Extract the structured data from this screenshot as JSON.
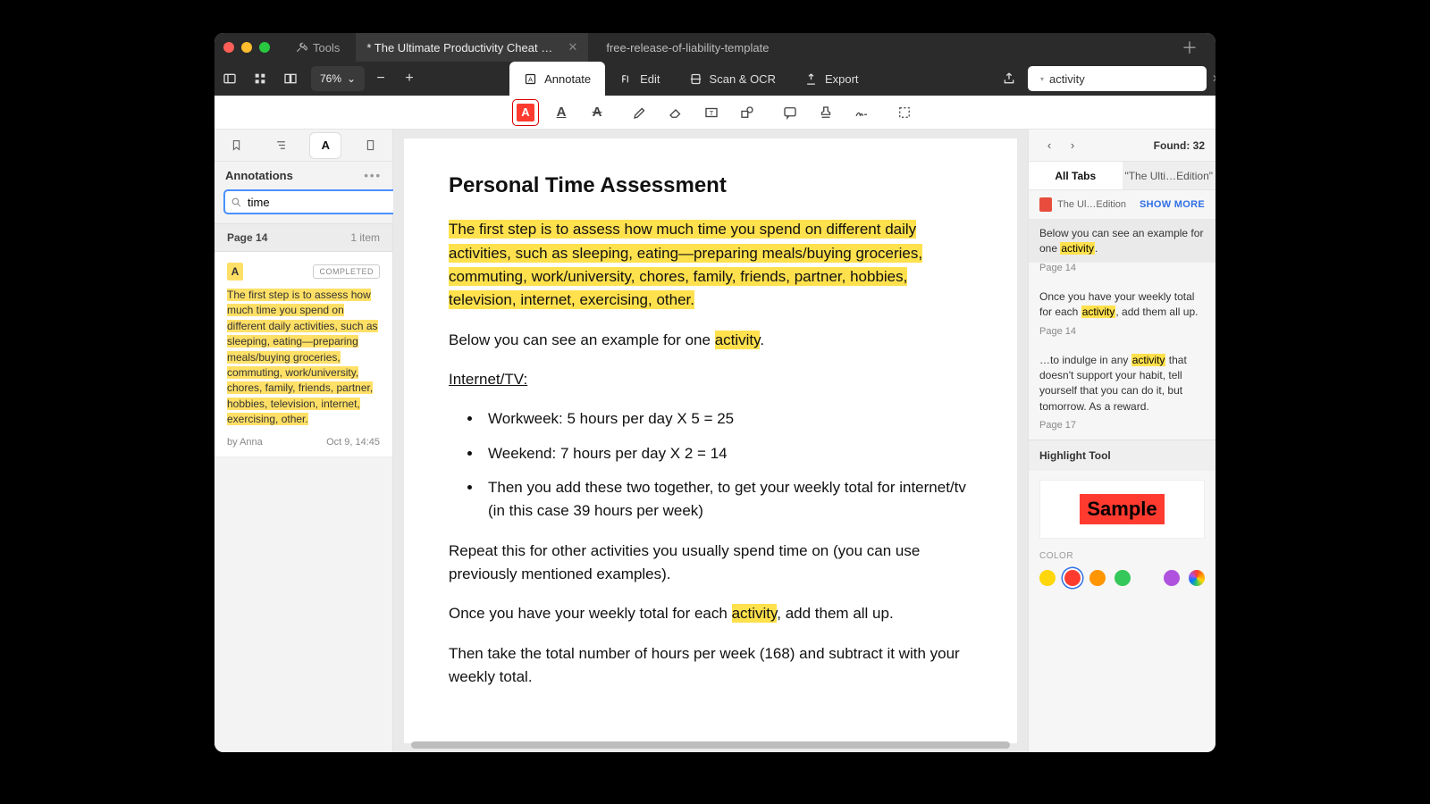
{
  "titlebar": {
    "tools_label": "Tools",
    "tabs": [
      {
        "title": "* The Ultimate Productivity Cheat Sheet - R…",
        "active": true
      },
      {
        "title": "free-release-of-liability-template",
        "active": false
      }
    ]
  },
  "toolbar": {
    "zoom": "76%",
    "modes": {
      "annotate": "Annotate",
      "edit": "Edit",
      "scan": "Scan & OCR",
      "export": "Export"
    },
    "search_value": "activity"
  },
  "sidebar": {
    "heading": "Annotations",
    "search_value": "time",
    "page_header": "Page 14",
    "page_count": "1 item",
    "card": {
      "badge": "A",
      "status": "COMPLETED",
      "text": "The first step is to assess how much time you spend on different daily activities, such as sleeping, eating—preparing meals/buying groceries, commuting, work/university, chores, family, friends, partner, hobbies, television, internet, exercising, other.",
      "author": "by Anna",
      "date": "Oct 9, 14:45"
    }
  },
  "document": {
    "h2": "Personal Time Assessment",
    "p1": "The first step is to assess how much time you spend on different daily activities, such as sleeping, eating—preparing meals/buying groceries, commuting, work/university, chores, family, friends, partner, hobbies, television, internet, exercising, other.",
    "p2_a": "Below you can see an example for one ",
    "p2_hl": "activity",
    "p2_b": ".",
    "section": "Internet/TV:",
    "li1": "Workweek: 5 hours per day X 5 = 25",
    "li2": "Weekend: 7 hours per day X 2 = 14",
    "li3": "Then you add these two together, to get your weekly total for internet/tv (in this case 39 hours per week)",
    "p3": "Repeat this for other activities you usually spend time on (you can use previously mentioned examples).",
    "p4_a": "Once you have your weekly total for each ",
    "p4_hl": "activity",
    "p4_b": ", add them all up.",
    "p5": "Then take the total number of hours per week (168) and subtract it with your weekly total."
  },
  "rightpanel": {
    "found": "Found: 32",
    "tabs": {
      "all": "All Tabs",
      "doc": "\"The Ulti…Edition\""
    },
    "doc_name": "The Ul…Edition",
    "show_more": "SHOW MORE",
    "hits": [
      {
        "pre": "Below you can see an example for one ",
        "kw": "activity",
        "post": ".",
        "page": "Page 14"
      },
      {
        "pre": "Once you have your weekly total for each ",
        "kw": "activity",
        "post": ", add them all up.",
        "page": "Page 14"
      },
      {
        "pre": "…to indulge in any ",
        "kw": "activity",
        "post": " that doesn't support your habit, tell yourself that you can do it, but tomorrow. As a reward.",
        "page": "Page 17"
      }
    ],
    "tool_heading": "Highlight Tool",
    "sample": "Sample",
    "color_label": "COLOR"
  }
}
